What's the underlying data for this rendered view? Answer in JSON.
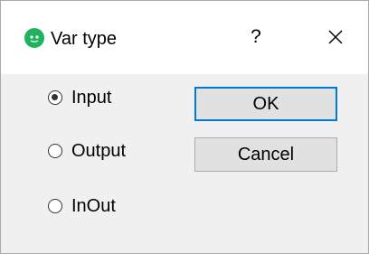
{
  "window": {
    "title": "Var type",
    "help_label": "?",
    "app_icon": "green-face-icon",
    "close_icon": "close-icon"
  },
  "options": [
    {
      "label": "Input",
      "selected": true
    },
    {
      "label": "Output",
      "selected": false
    },
    {
      "label": "InOut",
      "selected": false
    }
  ],
  "buttons": {
    "ok_label": "OK",
    "cancel_label": "Cancel"
  },
  "colors": {
    "app_icon": "#1fb35f",
    "default_button_border": "#0078d7",
    "button_face": "#e1e1e1",
    "dialog_background": "#f0f0f0"
  }
}
